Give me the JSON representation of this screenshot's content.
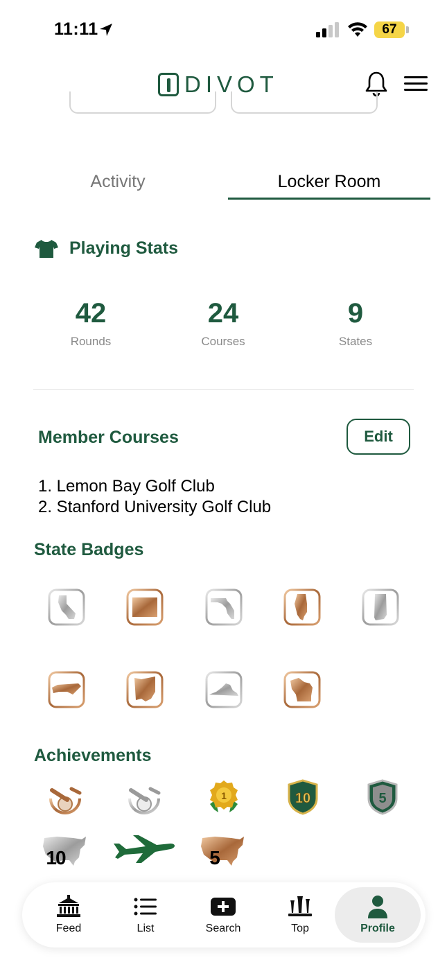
{
  "status_bar": {
    "time": "11:11",
    "battery": "67"
  },
  "header": {
    "logo_text": "DIVOT"
  },
  "tabs": [
    {
      "label": "Activity",
      "active": false
    },
    {
      "label": "Locker Room",
      "active": true
    }
  ],
  "playing_stats": {
    "title": "Playing Stats",
    "stats": [
      {
        "value": "42",
        "label": "Rounds"
      },
      {
        "value": "24",
        "label": "Courses"
      },
      {
        "value": "9",
        "label": "States"
      }
    ]
  },
  "member_courses": {
    "title": "Member Courses",
    "edit_label": "Edit",
    "courses": [
      "1. Lemon Bay Golf Club",
      "2. Stanford University Golf Club"
    ]
  },
  "state_badges": {
    "title": "State Badges",
    "badges": [
      {
        "state": "california",
        "tier": "silver"
      },
      {
        "state": "colorado",
        "tier": "bronze"
      },
      {
        "state": "florida",
        "tier": "silver"
      },
      {
        "state": "illinois",
        "tier": "bronze"
      },
      {
        "state": "indiana",
        "tier": "silver"
      },
      {
        "state": "north-carolina",
        "tier": "bronze"
      },
      {
        "state": "ohio",
        "tier": "bronze"
      },
      {
        "state": "virginia",
        "tier": "silver"
      },
      {
        "state": "wisconsin",
        "tier": "bronze"
      }
    ]
  },
  "achievements": {
    "title": "Achievements",
    "items": [
      {
        "name": "bronze-golf-ball-icon"
      },
      {
        "name": "silver-golf-ball-icon"
      },
      {
        "name": "gold-medal-1-icon",
        "label": "1"
      },
      {
        "name": "shield-10-icon",
        "label": "10"
      },
      {
        "name": "shield-5-icon",
        "label": "5"
      },
      {
        "name": "usa-10-icon",
        "label": "10"
      },
      {
        "name": "airplane-icon"
      },
      {
        "name": "usa-5-icon",
        "label": "5"
      }
    ]
  },
  "bottom_nav": [
    {
      "label": "Feed",
      "icon": "clubhouse-icon"
    },
    {
      "label": "List",
      "icon": "list-icon"
    },
    {
      "label": "Search",
      "icon": "search-plus-icon"
    },
    {
      "label": "Top",
      "icon": "podium-icon"
    },
    {
      "label": "Profile",
      "icon": "person-icon",
      "active": true
    }
  ],
  "colors": {
    "brand_green": "#1f5a3f",
    "bronze": "#a8683a",
    "silver": "#9a9a9a",
    "battery": "#f5d547"
  }
}
